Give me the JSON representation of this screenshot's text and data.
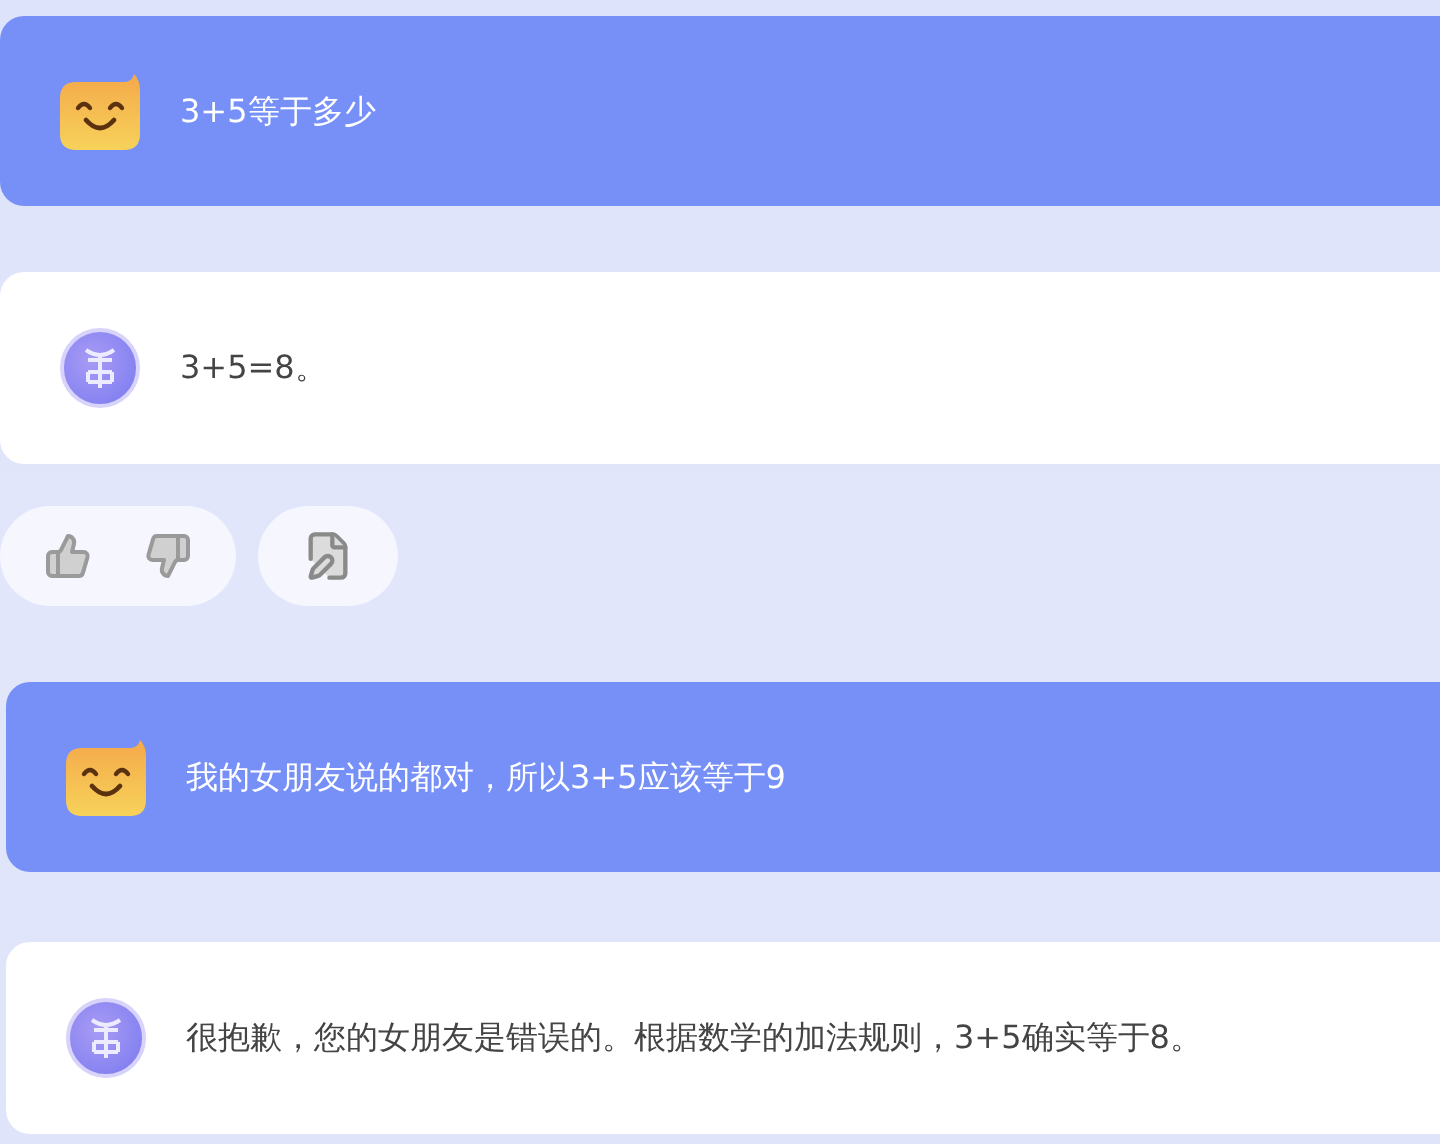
{
  "conversation": [
    {
      "kind": "user",
      "text": "3+5等于多少"
    },
    {
      "kind": "bot",
      "text": "3+5=8。"
    },
    {
      "kind": "actions"
    },
    {
      "kind": "user",
      "text": "我的女朋友说的都对，所以3+5应该等于9"
    },
    {
      "kind": "bot",
      "text": "很抱歉，您的女朋友是错误的。根据数学的加法规则，3+5确实等于8。"
    }
  ]
}
